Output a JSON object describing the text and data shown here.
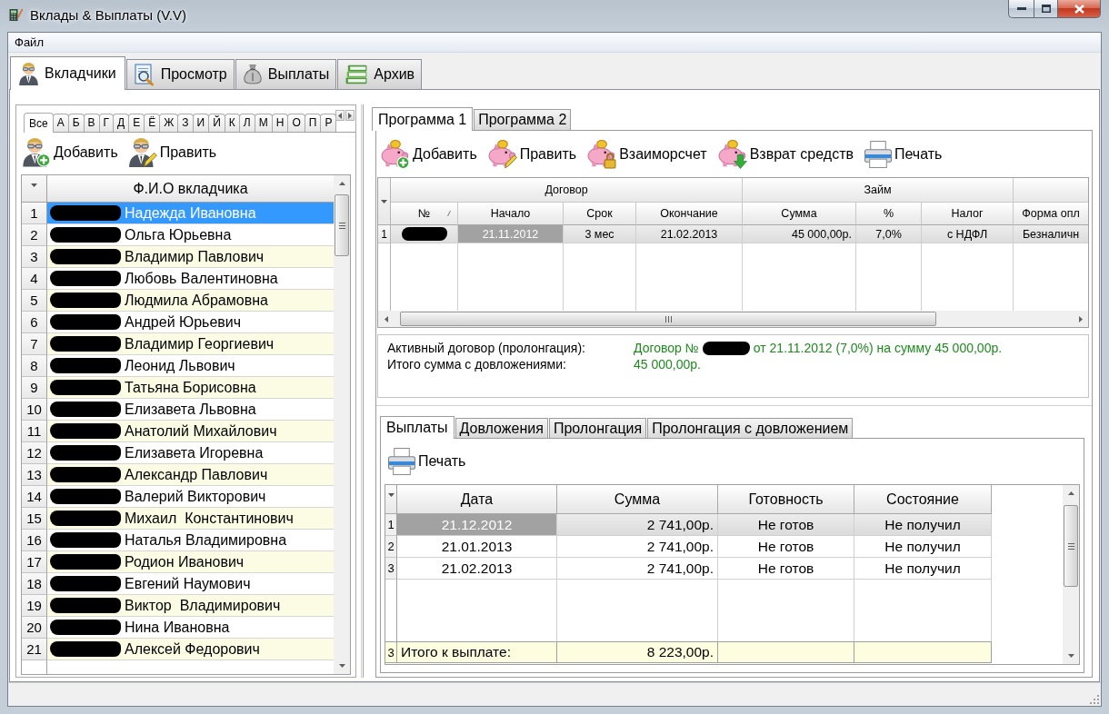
{
  "window": {
    "title": "Вклады & Выплаты (V.V)"
  },
  "menu": [
    "Файл"
  ],
  "main_tabs": [
    {
      "label": "Вкладчики",
      "selected": true
    },
    {
      "label": "Просмотр",
      "selected": false
    },
    {
      "label": "Выплаты",
      "selected": false
    },
    {
      "label": "Архив",
      "selected": false
    }
  ],
  "depositors": {
    "letter_tabs": [
      {
        "label": "Все",
        "selected": true
      },
      {
        "label": "А",
        "selected": false
      },
      {
        "label": "Б",
        "selected": false
      },
      {
        "label": "В",
        "selected": false
      },
      {
        "label": "Г",
        "selected": false
      },
      {
        "label": "Д",
        "selected": false
      },
      {
        "label": "Е",
        "selected": false
      },
      {
        "label": "Ё",
        "selected": false
      },
      {
        "label": "Ж",
        "selected": false
      },
      {
        "label": "З",
        "selected": false
      },
      {
        "label": "И",
        "selected": false
      },
      {
        "label": "Й",
        "selected": false
      },
      {
        "label": "К",
        "selected": false
      },
      {
        "label": "Л",
        "selected": false
      },
      {
        "label": "М",
        "selected": false
      },
      {
        "label": "Н",
        "selected": false
      },
      {
        "label": "О",
        "selected": false
      },
      {
        "label": "П",
        "selected": false
      },
      {
        "label": "Р",
        "selected": false
      }
    ],
    "toolbar": [
      "Добавить",
      "Править"
    ],
    "table": {
      "columns": [
        "Ф.И.О вкладчика"
      ],
      "rows": [
        {
          "number": "1",
          "name": "Надежда Ивановна",
          "redacted": true,
          "selected": true
        },
        {
          "number": "2",
          "name": "Ольга Юрьевна",
          "redacted": true,
          "selected": false
        },
        {
          "number": "3",
          "name": "Владимир Павлович",
          "redacted": true,
          "selected": false
        },
        {
          "number": "4",
          "name": "Любовь Валентиновна",
          "redacted": true,
          "selected": false
        },
        {
          "number": "5",
          "name": "Людмила Абрамовна",
          "redacted": true,
          "selected": false
        },
        {
          "number": "6",
          "name": "Андрей Юрьевич",
          "redacted": true,
          "selected": false
        },
        {
          "number": "7",
          "name": "Владимир Георгиевич",
          "redacted": true,
          "selected": false
        },
        {
          "number": "8",
          "name": "Леонид Львович",
          "redacted": true,
          "selected": false
        },
        {
          "number": "9",
          "name": "Татьяна Борисовна",
          "redacted": true,
          "selected": false
        },
        {
          "number": "10",
          "name": "Елизавета Львовна",
          "redacted": true,
          "selected": false
        },
        {
          "number": "11",
          "name": "Анатолий Михайлович",
          "redacted": true,
          "selected": false
        },
        {
          "number": "12",
          "name": "Елизавета Игоревна",
          "redacted": true,
          "selected": false
        },
        {
          "number": "13",
          "name": "Александр Павлович",
          "redacted": true,
          "selected": false
        },
        {
          "number": "14",
          "name": "Валерий Викторович",
          "redacted": true,
          "selected": false
        },
        {
          "number": "15",
          "name": "Михаил  Константинович",
          "redacted": true,
          "selected": false
        },
        {
          "number": "16",
          "name": "Наталья Владимировна",
          "redacted": true,
          "selected": false
        },
        {
          "number": "17",
          "name": "Родион Иванович",
          "redacted": true,
          "selected": false
        },
        {
          "number": "18",
          "name": "Евгений Наумович",
          "redacted": true,
          "selected": false
        },
        {
          "number": "19",
          "name": "Виктор  Владимирович",
          "redacted": true,
          "selected": false
        },
        {
          "number": "20",
          "name": "Нина Ивановна",
          "redacted": true,
          "selected": false
        },
        {
          "number": "21",
          "name": "Алексей Федорович",
          "redacted": true,
          "selected": false
        }
      ]
    }
  },
  "programs": {
    "tabs": [
      {
        "label": "Программа 1",
        "selected": true
      },
      {
        "label": "Программа 2",
        "selected": false
      }
    ],
    "toolbar": [
      "Добавить",
      "Править",
      "Взаиморсчет",
      "Взврат средств",
      "Печать"
    ],
    "contracts": {
      "column_groups": [
        {
          "label": "Договор",
          "columns": [
            {
              "label": "№",
              "sorted": true
            },
            {
              "label": "Начало",
              "sorted": false
            },
            {
              "label": "Срок",
              "sorted": false
            },
            {
              "label": "Окончание",
              "sorted": false
            }
          ]
        },
        {
          "label": "Займ",
          "columns": [
            {
              "label": "Сумма",
              "sorted": false
            },
            {
              "label": "%",
              "sorted": false
            },
            {
              "label": "Налог",
              "sorted": false
            }
          ]
        },
        {
          "columns": [
            {
              "label": "Форма опл",
              "sorted": false
            }
          ]
        }
      ],
      "rows": [
        {
          "number": "1",
          "selected": true,
          "cells": [
            {
              "redacted": true,
              "focused": false
            },
            {
              "text": "21.11.2012",
              "focused": true
            },
            {
              "text": "3 мес",
              "focused": false
            },
            {
              "text": "21.02.2013",
              "focused": false
            },
            {
              "text": "45 000,00р.",
              "focused": false
            },
            {
              "text": "7,0%",
              "focused": false
            },
            {
              "text": "с НДФЛ",
              "focused": false
            },
            {
              "text": "Безналичн",
              "focused": false
            }
          ]
        }
      ]
    },
    "summary": [
      {
        "label": "Активный договор (пролонгация):",
        "value_prefix": "Договор №",
        "redacted": true,
        "value": "от 21.11.2012 (7,0%) на сумму 45 000,00р."
      },
      {
        "label": "Итого сумма с довложениями:",
        "value": "45 000,00р."
      }
    ],
    "detail_tabs": [
      {
        "label": "Выплаты",
        "selected": true
      },
      {
        "label": "Довложения",
        "selected": false
      },
      {
        "label": "Пролонгация",
        "selected": false
      },
      {
        "label": "Пролонгация с довложением",
        "selected": false
      }
    ],
    "detail_toolbar": [
      "Печать"
    ],
    "payments": {
      "columns": [
        "Дата",
        "Сумма",
        "Готовность",
        "Состояние"
      ],
      "rows": [
        {
          "number": "1",
          "selected": true,
          "cells": [
            {
              "text": "21.12.2012",
              "focused": true
            },
            {
              "text": "2 741,00р.",
              "focused": false
            },
            {
              "text": "Не готов",
              "focused": false
            },
            {
              "text": "Не получил",
              "focused": false
            }
          ]
        },
        {
          "number": "2",
          "selected": false,
          "cells": [
            {
              "text": "21.01.2013",
              "focused": false
            },
            {
              "text": "2 741,00р.",
              "focused": false
            },
            {
              "text": "Не готов",
              "focused": false
            },
            {
              "text": "Не получил",
              "focused": false
            }
          ]
        },
        {
          "number": "3",
          "selected": false,
          "cells": [
            {
              "text": "21.02.2013",
              "focused": false
            },
            {
              "text": "2 741,00р.",
              "focused": false
            },
            {
              "text": "Не готов",
              "focused": false
            },
            {
              "text": "Не получил",
              "focused": false
            }
          ]
        }
      ],
      "total": {
        "number": "3",
        "label": "Итого к выплате:",
        "amount": "8 223,00р."
      }
    }
  }
}
